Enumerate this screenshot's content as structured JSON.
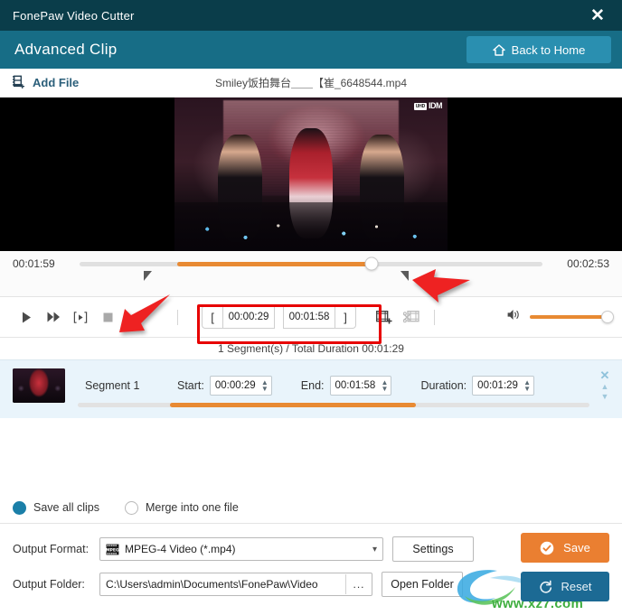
{
  "window": {
    "title": "FonePaw Video Cutter",
    "close_icon": "close-icon"
  },
  "subheader": {
    "mode_label": "Advanced Clip",
    "back_home_label": "Back to Home",
    "home_icon": "home-icon",
    "bg_color": "#176d86",
    "button_color": "#2a8fb0"
  },
  "filebar": {
    "add_file_label": "Add File",
    "add_file_icon": "film-add-icon",
    "file_name": "Smiley饭拍舞台＿＿【崔_6648544.mp4"
  },
  "timeline": {
    "start_time": "00:01:59",
    "end_time": "00:02:53",
    "playhead_icon": "playhead-knob",
    "left_handle_icon": "trim-left-handle",
    "right_handle_icon": "trim-right-handle"
  },
  "controls": {
    "play_icon": "play-icon",
    "forward_icon": "fast-forward-icon",
    "frame_step_icon": "frame-step-icon",
    "stop_icon": "stop-icon",
    "mark_in_icon": "mark-in-bracket-icon",
    "mark_out_icon": "mark-out-bracket-icon",
    "trim_start_value": "00:00:29",
    "trim_end_value": "00:01:58",
    "add_segment_icon": "add-segment-icon",
    "split_segment_icon": "split-segment-icon",
    "volume_icon": "volume-icon",
    "volume_level": 100
  },
  "segments": {
    "summary": "1 Segment(s) / Total Duration 00:01:29",
    "rows": [
      {
        "thumbnail_icon": "segment-thumbnail",
        "name": "Segment 1",
        "start_label": "Start:",
        "start_value": "00:00:29",
        "end_label": "End:",
        "end_value": "00:01:58",
        "duration_label": "Duration:",
        "duration_value": "00:01:29",
        "remove_icon": "close-icon",
        "move_up_icon": "caret-up-icon",
        "move_down_icon": "caret-down-icon"
      }
    ]
  },
  "save_mode": {
    "option_all_label": "Save all clips",
    "option_merge_label": "Merge into one file",
    "selected": "Save all clips",
    "accent_color": "#1b7fa8"
  },
  "output": {
    "format_label": "Output Format:",
    "format_value": "MPEG-4 Video (*.mp4)",
    "format_icon": "mpeg-icon",
    "chevron_icon": "chevron-down-icon",
    "settings_label": "Settings",
    "folder_label": "Output Folder:",
    "folder_value": "C:\\Users\\admin\\Documents\\FonePaw\\Video",
    "browse_label": "...",
    "open_folder_label": "Open Folder",
    "save_label": "Save",
    "save_icon": "check-circle-icon",
    "save_color": "#ea7f31",
    "reset_label": "Reset",
    "reset_icon": "reset-circular-arrow-icon",
    "reset_color": "#1c6a94"
  },
  "annotations": {
    "highlight_color": "#e70000",
    "arrow_color": "#ee2222",
    "arrow_left_name": "annotation-arrow-to-trim-fields",
    "arrow_right_name": "annotation-arrow-to-right-handle",
    "highlight_name": "annotation-highlight-trim-fields"
  },
  "watermark": {
    "text": "www.xz7.com"
  },
  "preview": {
    "badge_small": "UHD",
    "badge_large": "IDM"
  }
}
